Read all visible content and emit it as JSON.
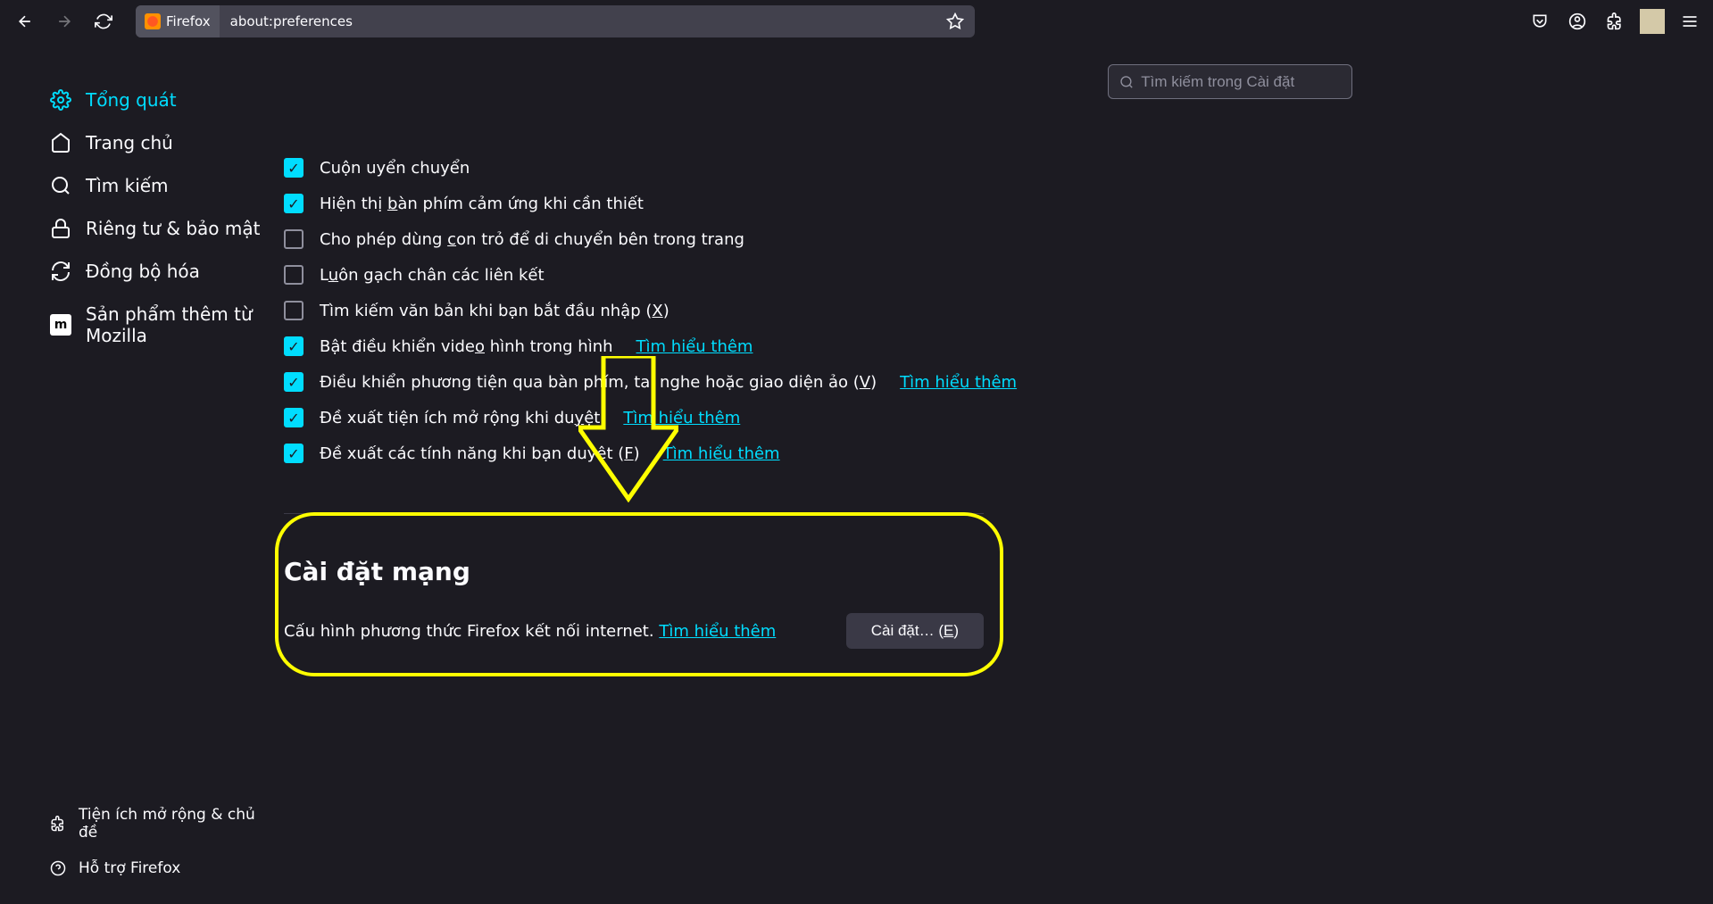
{
  "toolbar": {
    "identity_label": "Firefox",
    "url": "about:preferences"
  },
  "search": {
    "placeholder": "Tìm kiếm trong Cài đặt"
  },
  "sidebar": {
    "items": [
      {
        "label": "Tổng quát"
      },
      {
        "label": "Trang chủ"
      },
      {
        "label": "Tìm kiếm"
      },
      {
        "label": "Riêng tư & bảo mật"
      },
      {
        "label": "Đồng bộ hóa"
      },
      {
        "label": "Sản phẩm thêm từ Mozilla"
      }
    ],
    "bottom": [
      {
        "label": "Tiện ích mở rộng & chủ đề"
      },
      {
        "label": "Hỗ trợ Firefox"
      }
    ]
  },
  "options": {
    "smooth_scroll": "Cuộn uyển chuyển",
    "touch_keyboard_pre": "Hiện thị ",
    "touch_keyboard_u": "b",
    "touch_keyboard_post": "àn phím cảm ứng khi cần thiết",
    "caret_pre": "Cho phép dùng ",
    "caret_u": "c",
    "caret_post": "on trỏ để di chuyển bên trong trang",
    "underline_pre": "L",
    "underline_u": "u",
    "underline_post": "ôn gạch chân các liên kết",
    "search_text_pre": "Tìm kiếm văn bản khi bạn bắt đầu nhập (",
    "search_text_u": "X",
    "search_text_post": ")",
    "pip_pre": "Bật điều khiển vide",
    "pip_u": "o",
    "pip_post": " hình trong hình",
    "media_ctrl_pre": "Điều khiển phương tiện qua bàn phím, tai nghe hoặc giao diện ảo (",
    "media_ctrl_u": "V",
    "media_ctrl_post": ")",
    "recommend_ext_pre": "Đề xuất tiện ích mở rộng khi du",
    "recommend_ext_u": "y",
    "recommend_ext_post": "ệt",
    "recommend_feat_pre": "Đề xuất các tính năng khi bạn duyệt (",
    "recommend_feat_u": "F",
    "recommend_feat_post": ")",
    "learn_more": "Tìm hiểu thêm"
  },
  "network": {
    "title": "Cài đặt mạng",
    "desc": "Cấu hình phương thức Firefox kết nối internet.",
    "learn_more": "Tìm hiểu thêm",
    "settings_btn_pre": "Cài đặt… (",
    "settings_btn_u": "E",
    "settings_btn_post": ")"
  }
}
